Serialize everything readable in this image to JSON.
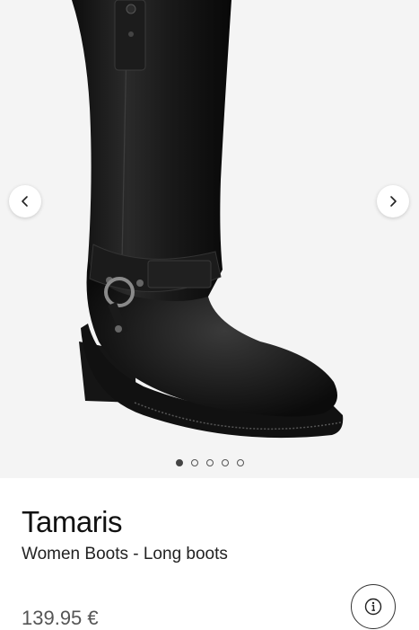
{
  "product": {
    "brand": "Tamaris",
    "subtitle": "Women Boots - Long boots",
    "price": "139.95 €"
  },
  "gallery": {
    "image_count": 5,
    "active_index": 0,
    "prev_icon": "chevron-left-icon",
    "next_icon": "chevron-right-icon"
  },
  "actions": {
    "info_icon": "info-icon"
  },
  "colors": {
    "gallery_background": "#f4f4f4",
    "text_primary": "#111111",
    "price_text": "#555555"
  }
}
